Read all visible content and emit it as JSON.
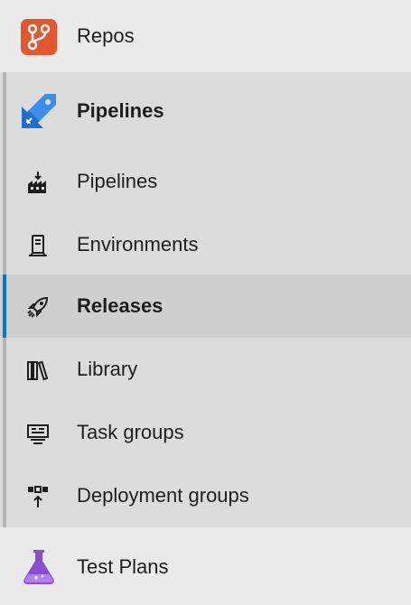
{
  "nav": {
    "repos": {
      "label": "Repos",
      "icon": "repos-icon",
      "color": "#e4572e"
    },
    "pipelines_group": {
      "label": "Pipelines",
      "icon": "pipelines-service-icon",
      "color": "#1e6fd0",
      "items": [
        {
          "label": "Pipelines",
          "icon": "pipelines-factory-icon",
          "selected": false
        },
        {
          "label": "Environments",
          "icon": "environments-server-icon",
          "selected": false
        },
        {
          "label": "Releases",
          "icon": "releases-rocket-icon",
          "selected": true
        },
        {
          "label": "Library",
          "icon": "library-books-icon",
          "selected": false
        },
        {
          "label": "Task groups",
          "icon": "task-groups-icon",
          "selected": false
        },
        {
          "label": "Deployment groups",
          "icon": "deployment-groups-icon",
          "selected": false
        }
      ]
    },
    "test_plans": {
      "label": "Test Plans",
      "icon": "test-plans-flask-icon",
      "color": "#8a4fd0"
    }
  },
  "colors": {
    "background": "#eaeaea",
    "group_background": "#dcdcdc",
    "selected_background": "#cfcfcf",
    "selected_indicator": "#0078d4",
    "group_rail": "#b4b4b4"
  }
}
